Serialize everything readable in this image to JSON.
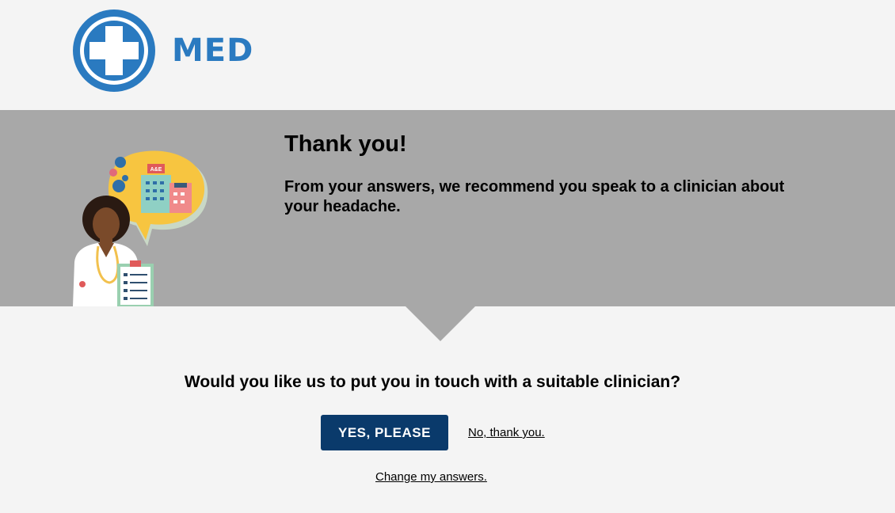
{
  "brand": {
    "name": "MED",
    "color": "#2a7ac0",
    "icon": "medical-cross-icon"
  },
  "illustration": {
    "sign_text": "A&E",
    "icon": "doctor-illustration"
  },
  "banner": {
    "title": "Thank you!",
    "message": "From your answers, we recommend you speak to a clinician about your headache.",
    "background": "#a8a8a8"
  },
  "question": "Would you like us to put you in touch with a suitable clinician?",
  "actions": {
    "yes_label": "YES, PLEASE",
    "no_label": "No, thank you.",
    "change_label": "Change my answers.",
    "primary_color": "#0a3a6b"
  }
}
